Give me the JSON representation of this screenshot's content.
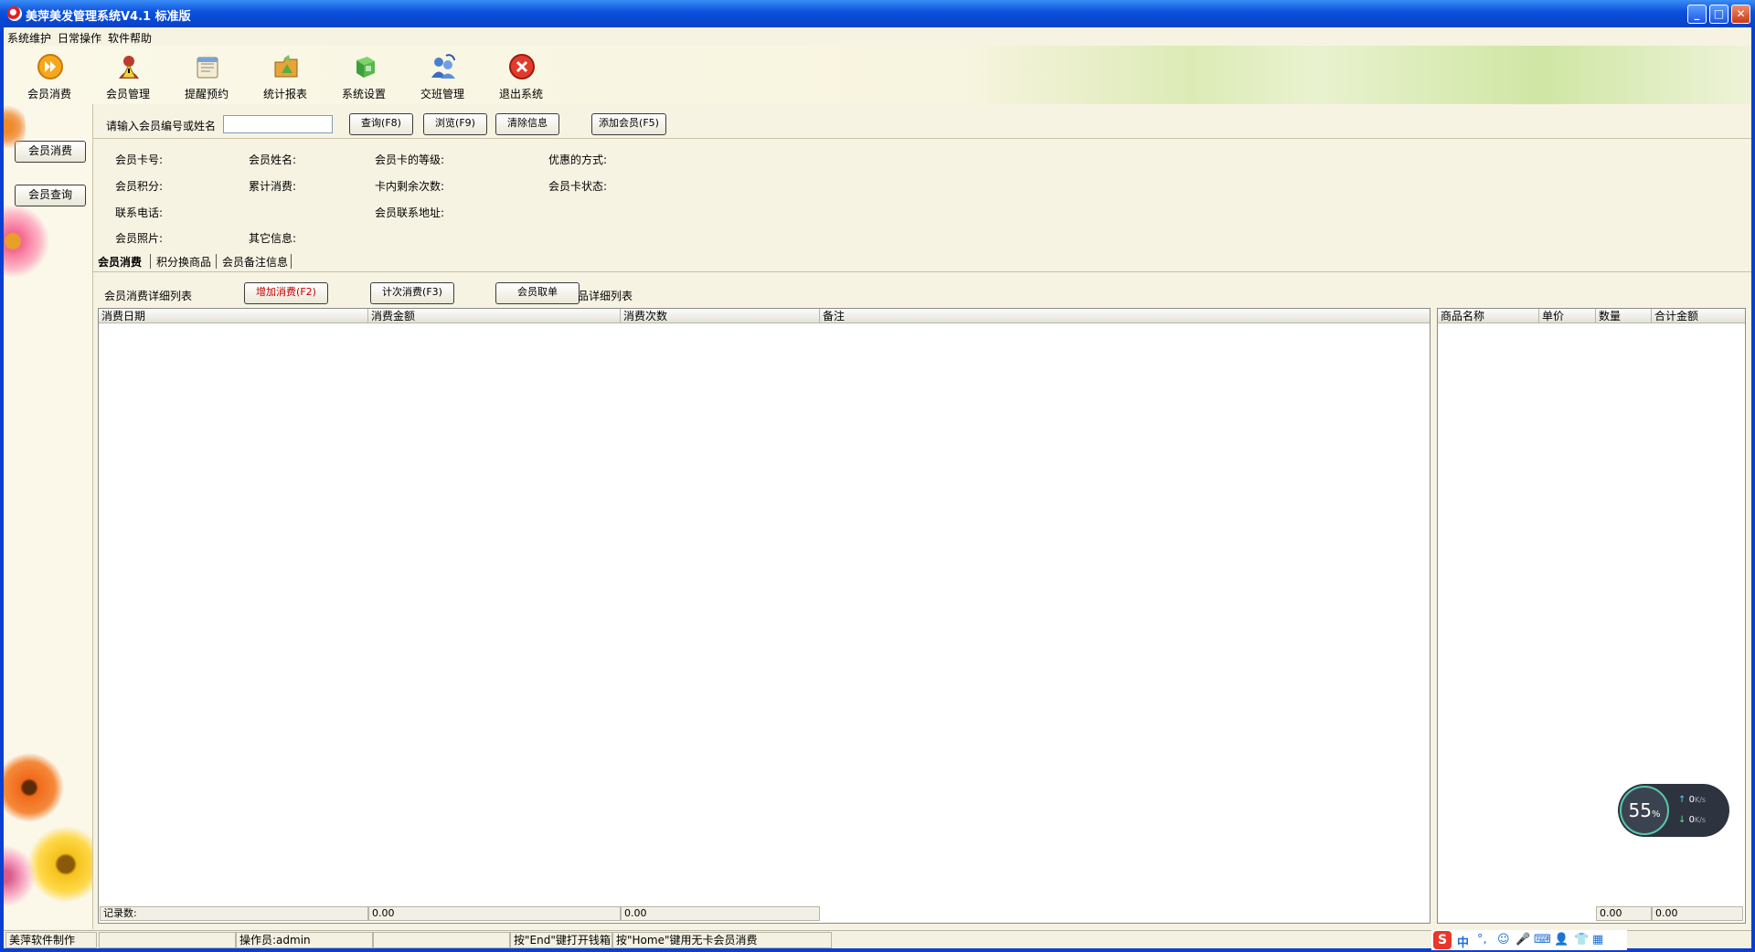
{
  "window": {
    "title": "美萍美发管理系统V4.1 标准版"
  },
  "menu": [
    "系统维护",
    "日常操作",
    "软件帮助"
  ],
  "toolbar": [
    {
      "label": "会员消费",
      "icon": "play-circle-icon"
    },
    {
      "label": "会员管理",
      "icon": "member-warning-icon"
    },
    {
      "label": "提醒预约",
      "icon": "calendar-note-icon"
    },
    {
      "label": "统计报表",
      "icon": "report-folder-icon"
    },
    {
      "label": "系统设置",
      "icon": "settings-box-icon"
    },
    {
      "label": "交班管理",
      "icon": "shift-users-icon"
    },
    {
      "label": "退出系统",
      "icon": "exit-x-icon"
    }
  ],
  "sidebar": {
    "items": [
      "会员消费",
      "会员查询"
    ]
  },
  "search": {
    "label": "请输入会员编号或姓名",
    "value": "",
    "query_btn": "查询(F8)",
    "browse_btn": "浏览(F9)",
    "clear_btn": "清除信息",
    "add_btn": "添加会员(F5)"
  },
  "info": {
    "card_no": "会员卡号:",
    "name": "会员姓名:",
    "level": "会员卡的等级:",
    "discount": "优惠的方式:",
    "points": "会员积分:",
    "total": "累计消费:",
    "remaining": "卡内剩余次数:",
    "status": "会员卡状态:",
    "phone": "联系电话:",
    "address": "会员联系地址:",
    "photo": "会员照片:",
    "other": "其它信息:"
  },
  "tabs": [
    "会员消费",
    "积分换商品",
    "会员备注信息"
  ],
  "consume": {
    "list_title": "会员消费详细列表",
    "add_btn": "增加消费(F2)",
    "count_btn": "计次消费(F3)",
    "order_btn": "会员取单",
    "goods_title_suffix": "品详细列表"
  },
  "main_grid": {
    "columns": [
      "消费日期",
      "消费金额",
      "消费次数",
      "备注"
    ],
    "footer": {
      "records_label": "记录数:",
      "amount": "0.00",
      "count": "0.00"
    }
  },
  "goods_grid": {
    "columns": [
      "商品名称",
      "单价",
      "数量",
      "合计金额"
    ],
    "footer": {
      "qty": "0.00",
      "total": "0.00"
    }
  },
  "statusbar": {
    "maker": "美萍软件制作",
    "operator": "操作员:admin",
    "hint_end": "按\"End\"键打开钱箱",
    "hint_home": "按\"Home\"键用无卡会员消费"
  },
  "ime": {
    "mode": "中"
  },
  "net_widget": {
    "percent": "55",
    "percent_unit": "%",
    "up": "0",
    "down": "0",
    "unit": "K/s"
  },
  "colors": {
    "titlebar": "#0a4fdc",
    "background": "#f7f3e3",
    "accent_red": "#c00000"
  }
}
